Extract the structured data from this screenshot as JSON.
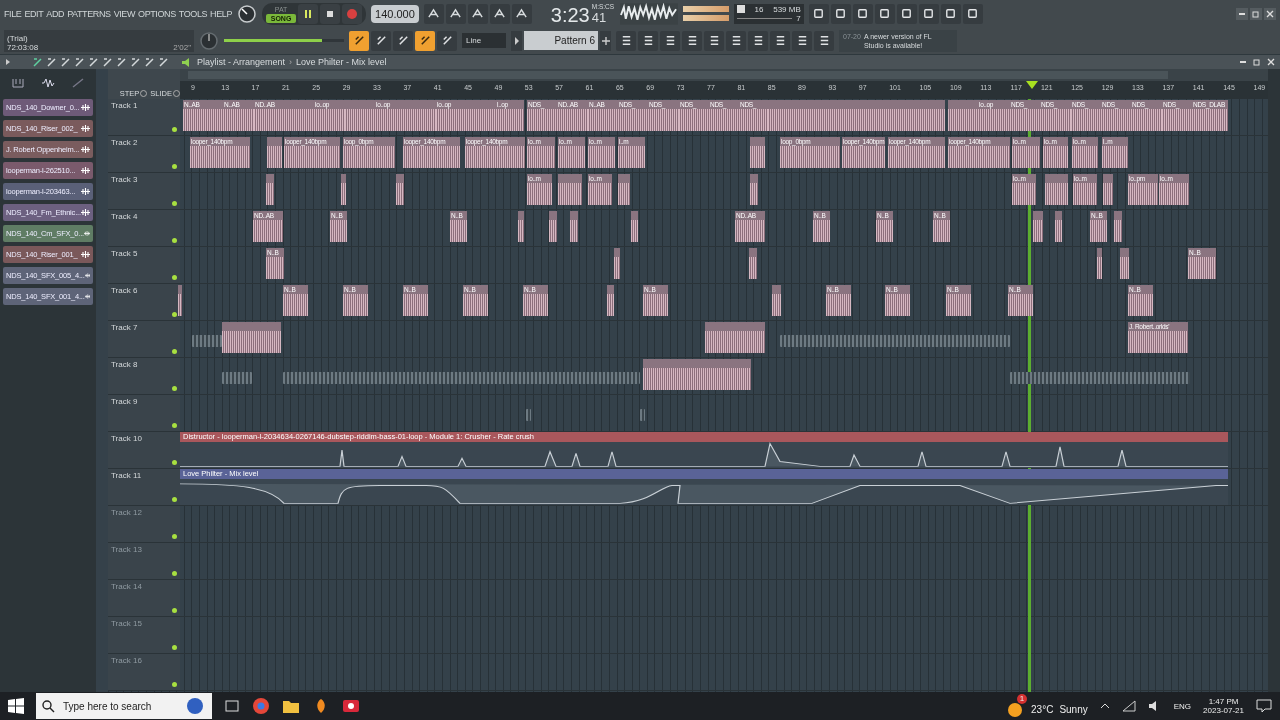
{
  "menu": [
    "FILE",
    "EDIT",
    "ADD",
    "PATTERNS",
    "VIEW",
    "OPTIONS",
    "TOOLS",
    "HELP"
  ],
  "hint": {
    "line1": "(Trial)",
    "line2": "72:03:08",
    "duration": "2'02\""
  },
  "modes": [
    {
      "label": "PAT",
      "selected": false
    },
    {
      "label": "SONG",
      "selected": true
    }
  ],
  "playing": true,
  "tempo": "140.000",
  "time": {
    "value": "3:23",
    "cs": "41",
    "unit": "M:S:CS"
  },
  "cpu": {
    "value": "16",
    "memory": "539 MB",
    "polyphony": "7"
  },
  "master_volume": {
    "level": 0.82
  },
  "toggles": [
    {
      "on": true
    },
    {
      "on": false
    },
    {
      "on": false
    },
    {
      "on": true
    },
    {
      "on": false
    }
  ],
  "snap": {
    "value": "Line"
  },
  "pattern": {
    "value": "Pattern 6"
  },
  "news": {
    "date": "07-20",
    "text": "A newer version of FL Studio is available!"
  },
  "playlist": {
    "title": "Playlist - Arrangement",
    "breadcrumb": "Love Philter - Mix level",
    "separator": "›",
    "step_label": "STEP",
    "slide_label": "SLIDE",
    "ruler": [
      "9",
      "13",
      "17",
      "21",
      "25",
      "29",
      "33",
      "37",
      "41",
      "45",
      "49",
      "53",
      "57",
      "61",
      "65",
      "69",
      "73",
      "77",
      "81",
      "85",
      "89",
      "93",
      "97",
      "101",
      "105",
      "109",
      "113",
      "117",
      "121",
      "125",
      "129",
      "133",
      "137",
      "141",
      "145",
      "149"
    ],
    "patterns": [
      {
        "name": "NDS_140_Downer_0...",
        "color": "#6e5a78"
      },
      {
        "name": "NDS_140_Riser_002_",
        "color": "#7a5a5c"
      },
      {
        "name": "J. Robert Oppenheim...",
        "color": "#7a5c5e"
      },
      {
        "name": "looperman-l-262510...",
        "color": "#7a5a6c"
      },
      {
        "name": "looperman-l-203463...",
        "color": "#5a6078"
      },
      {
        "name": "NDS_140_Fm_Ethnic...",
        "color": "#6c6080"
      },
      {
        "name": "NDS_140_Cm_SFX_0...",
        "color": "#5f7c64"
      },
      {
        "name": "NDS_140_Riser_001_",
        "color": "#7a585a"
      },
      {
        "name": "NDS_140_SFX_005_4...",
        "color": "#5e6478"
      },
      {
        "name": "NDS_140_SFX_001_4...",
        "color": "#5e6478"
      }
    ],
    "tracks": [
      {
        "name": "Track 1",
        "kind": "clips",
        "dimmed": false,
        "clips": [
          {
            "kind": "audio",
            "label": "N..AB"
          },
          {
            "kind": "audio",
            "label": "N..AB"
          },
          {
            "kind": "audio",
            "label": "ND..AB"
          },
          {
            "kind": "audio"
          },
          {
            "kind": "audio",
            "label": "lo..op"
          },
          {
            "kind": "audio"
          },
          {
            "kind": "audio",
            "label": "lo..op"
          },
          {
            "kind": "audio"
          },
          {
            "kind": "audio",
            "label": "lo..op"
          },
          {
            "kind": "audio"
          },
          {
            "kind": "audio",
            "label": "l..op"
          },
          {
            "kind": "audio",
            "label": "NDS_"
          },
          {
            "kind": "audio",
            "label": "ND..AB"
          },
          {
            "kind": "audio",
            "label": "N..AB"
          },
          {
            "kind": "audio",
            "label": "NDS_"
          },
          {
            "kind": "audio",
            "label": "NDS_"
          },
          {
            "kind": "audio",
            "label": "NDS_"
          },
          {
            "kind": "audio",
            "label": "NDS_"
          },
          {
            "kind": "audio",
            "label": "NDS_"
          },
          {
            "kind": "audio"
          },
          {
            "kind": "audio"
          },
          {
            "kind": "audio",
            "label": "lo..op"
          },
          {
            "kind": "audio",
            "label": "NDS_"
          },
          {
            "kind": "audio",
            "label": "NDS_"
          },
          {
            "kind": "audio",
            "label": "NDS_"
          },
          {
            "kind": "audio",
            "label": "NDS_"
          },
          {
            "kind": "audio",
            "label": "NDS_"
          },
          {
            "kind": "audio",
            "label": "NDS_"
          },
          {
            "kind": "audio",
            "label": "NDS_DLAB"
          }
        ]
      },
      {
        "name": "Track 2",
        "kind": "clips",
        "dimmed": false,
        "clips": [
          {
            "kind": "audio",
            "label": "looper_140bpm"
          },
          {
            "kind": "audio"
          },
          {
            "kind": "audio",
            "label": "looper_140bpm"
          },
          {
            "kind": "audio",
            "label": "loop_0bpm"
          },
          {
            "kind": "audio",
            "label": "looper_140bpm"
          },
          {
            "kind": "audio",
            "label": "looper_140bpm"
          },
          {
            "kind": "audio",
            "label": "lo..m"
          },
          {
            "kind": "audio",
            "label": "lo..m"
          },
          {
            "kind": "audio",
            "label": "lo..m"
          },
          {
            "kind": "audio",
            "label": "l..m"
          },
          {
            "kind": "audio"
          },
          {
            "kind": "audio",
            "label": "loop_0bpm"
          },
          {
            "kind": "audio",
            "label": "looper_140bpm"
          },
          {
            "kind": "audio",
            "label": "looper_140bpm"
          },
          {
            "kind": "audio",
            "label": "looper_140bpm"
          },
          {
            "kind": "audio",
            "label": "lo..m"
          },
          {
            "kind": "audio",
            "label": "lo..m"
          },
          {
            "kind": "audio",
            "label": "lo..m"
          },
          {
            "kind": "audio",
            "label": "l..m"
          }
        ]
      },
      {
        "name": "Track 3",
        "kind": "clips",
        "dimmed": false,
        "clips": [
          {
            "kind": "audio"
          },
          {
            "kind": "audio"
          },
          {
            "kind": "audio"
          },
          {
            "kind": "audio",
            "label": "lo..m"
          },
          {
            "kind": "audio"
          },
          {
            "kind": "audio",
            "label": "lo..m"
          },
          {
            "kind": "audio"
          },
          {
            "kind": "audio"
          },
          {
            "kind": "audio",
            "label": "lo..m"
          },
          {
            "kind": "audio"
          },
          {
            "kind": "audio",
            "label": "lo..m"
          },
          {
            "kind": "audio"
          },
          {
            "kind": "audio",
            "label": "lo..pm"
          },
          {
            "kind": "audio",
            "label": "lo..m"
          }
        ]
      },
      {
        "name": "Track 4",
        "kind": "clips",
        "dimmed": false,
        "clips": [
          {
            "kind": "audio",
            "label": "ND..AB"
          },
          {
            "kind": "audio",
            "label": "N..B"
          },
          {
            "kind": "audio",
            "label": "N..B"
          },
          {
            "kind": "audio"
          },
          {
            "kind": "audio"
          },
          {
            "kind": "audio"
          },
          {
            "kind": "audio"
          },
          {
            "kind": "audio",
            "label": "ND..AB"
          },
          {
            "kind": "audio",
            "label": "N..B"
          },
          {
            "kind": "audio",
            "label": "N..B"
          },
          {
            "kind": "audio",
            "label": "N..B"
          },
          {
            "kind": "audio"
          },
          {
            "kind": "audio"
          },
          {
            "kind": "audio",
            "label": "N..B"
          },
          {
            "kind": "audio"
          }
        ]
      },
      {
        "name": "Track 5",
        "kind": "clips",
        "dimmed": false,
        "clips": [
          {
            "kind": "audio",
            "label": "N..B"
          },
          {
            "kind": "audio"
          },
          {
            "kind": "audio"
          },
          {
            "kind": "audio"
          },
          {
            "kind": "audio"
          },
          {
            "kind": "audio",
            "label": "N..B"
          }
        ]
      },
      {
        "name": "Track 6",
        "kind": "clips",
        "dimmed": false,
        "clips": [
          {
            "kind": "audio"
          },
          {
            "kind": "audio",
            "label": "N..B"
          },
          {
            "kind": "audio",
            "label": "N..B"
          },
          {
            "kind": "audio",
            "label": "N..B"
          },
          {
            "kind": "audio",
            "label": "N..B"
          },
          {
            "kind": "audio",
            "label": "N..B"
          },
          {
            "kind": "audio"
          },
          {
            "kind": "audio",
            "label": "N..B"
          },
          {
            "kind": "audio"
          },
          {
            "kind": "audio",
            "label": "N..B"
          },
          {
            "kind": "audio",
            "label": "N..B"
          },
          {
            "kind": "audio",
            "label": "N..B"
          },
          {
            "kind": "audio",
            "label": "N..B"
          },
          {
            "kind": "audio",
            "label": "N..B"
          }
        ]
      },
      {
        "name": "Track 7",
        "kind": "clips",
        "dimmed": false,
        "clips": [
          {
            "kind": "pattern"
          },
          {
            "kind": "audio"
          },
          {
            "kind": "audio"
          },
          {
            "kind": "pattern"
          },
          {
            "kind": "audio",
            "label": "J. Robert..orlds'"
          }
        ]
      },
      {
        "name": "Track 8",
        "kind": "clips",
        "dimmed": false,
        "clips": [
          {
            "kind": "pattern"
          },
          {
            "kind": "pattern"
          },
          {
            "kind": "audio"
          },
          {
            "kind": "pattern"
          }
        ]
      },
      {
        "name": "Track 9",
        "kind": "clips",
        "dimmed": false,
        "clips": [
          {
            "kind": "pattern"
          },
          {
            "kind": "pattern"
          }
        ]
      },
      {
        "name": "Track 10",
        "kind": "automation",
        "dimmed": false,
        "title": "Distructor - looperman-l-2034634-0267146-dubstep-riddim-bass-01-loop - Module 1: Crusher - Rate crush",
        "color": "#a9575c"
      },
      {
        "name": "Track 11",
        "kind": "automation",
        "dimmed": false,
        "title": "Love Philter - Mix level",
        "color": "#5a6397"
      },
      {
        "name": "Track 12",
        "kind": "empty",
        "dimmed": true
      },
      {
        "name": "Track 13",
        "kind": "empty",
        "dimmed": true
      },
      {
        "name": "Track 14",
        "kind": "empty",
        "dimmed": true
      },
      {
        "name": "Track 15",
        "kind": "empty",
        "dimmed": true
      },
      {
        "name": "Track 16",
        "kind": "empty",
        "dimmed": true
      }
    ]
  },
  "taskbar": {
    "search_placeholder": "Type here to search",
    "weather_badge": "1",
    "temperature": "23°C",
    "condition": "Sunny",
    "language": "ENG",
    "time": "1:47 PM",
    "date": "2023-07-21"
  }
}
